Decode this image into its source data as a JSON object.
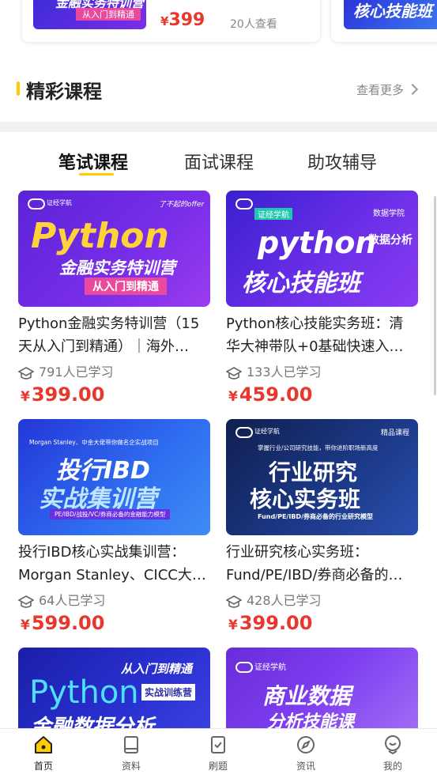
{
  "top_row": {
    "card1": {
      "thumb_line1": "金融实务特训营",
      "thumb_line2": "从入门到精通",
      "price_symbol": "¥",
      "price": "399",
      "views": "20人查看"
    },
    "card2": {
      "thumb_text": "核心技能班"
    }
  },
  "section": {
    "title": "精彩课程",
    "see_more": "查看更多"
  },
  "tabs": [
    {
      "label": "笔试课程",
      "active": true
    },
    {
      "label": "面试课程",
      "active": false
    },
    {
      "label": "助攻辅导",
      "active": false
    }
  ],
  "courses": [
    {
      "thumb": {
        "brand": "证经学航",
        "tag": "了不起的offer",
        "big": "Python",
        "sub": "金融实务特训营",
        "badge": "从入门到精通"
      },
      "title_line1": "Python金融实务特训营（15",
      "title_line2": "天从入门到精通）｜海外…",
      "learners": "791人已学习",
      "price_symbol": "¥",
      "price": "399.00"
    },
    {
      "thumb": {
        "brand": "证经学航",
        "tag": "数据学院",
        "big": "python",
        "sub_small": "数据分析",
        "sub": "核心技能班"
      },
      "title_line1": "Python核心技能实务班：清",
      "title_line2": "华大神带队+0基础快速入…",
      "learners": "133人已学习",
      "price_symbol": "¥",
      "price": "459.00"
    },
    {
      "thumb": {
        "top": "Morgan Stanley、中金大佬带你做名企实战项目",
        "big1": "投行IBD",
        "big2": "实战集训营",
        "foot": "PE/IBD/战投/VC/券商必备的金融能力模型"
      },
      "title_line1": "投行IBD核心实战集训营：",
      "title_line2": "Morgan Stanley、CICC大…",
      "learners": "64人已学习",
      "price_symbol": "¥",
      "price": "599.00"
    },
    {
      "thumb": {
        "brand": "证经学航",
        "tag": "精品课程",
        "top": "掌握行业/公司研究技能，带你进阶职场新高度",
        "big1": "行业研究",
        "big2": "核心实务班",
        "foot": "Fund/PE/IBD/券商必备的行业研究模型"
      },
      "title_line1": "行业研究核心实务班：",
      "title_line2": "Fund/PE/IBD/券商必备的…",
      "learners": "428人已学习",
      "price_symbol": "¥",
      "price": "399.00"
    },
    {
      "thumb": {
        "top": "从入门到精通",
        "big": "Python",
        "badge": "实战训练营",
        "sub": "金融数据分析"
      }
    },
    {
      "thumb": {
        "brand": "证经学航",
        "big1": "商业数据",
        "big2": "分析技能课"
      }
    }
  ],
  "bottom_nav": [
    {
      "label": "首页",
      "icon": "home-icon",
      "active": true
    },
    {
      "label": "资料",
      "icon": "book-icon",
      "active": false
    },
    {
      "label": "刷题",
      "icon": "checklist-icon",
      "active": false
    },
    {
      "label": "资讯",
      "icon": "compass-icon",
      "active": false
    },
    {
      "label": "我的",
      "icon": "profile-icon",
      "active": false
    }
  ],
  "colors": {
    "accent": "#ffcc00",
    "price": "#e8372d"
  }
}
